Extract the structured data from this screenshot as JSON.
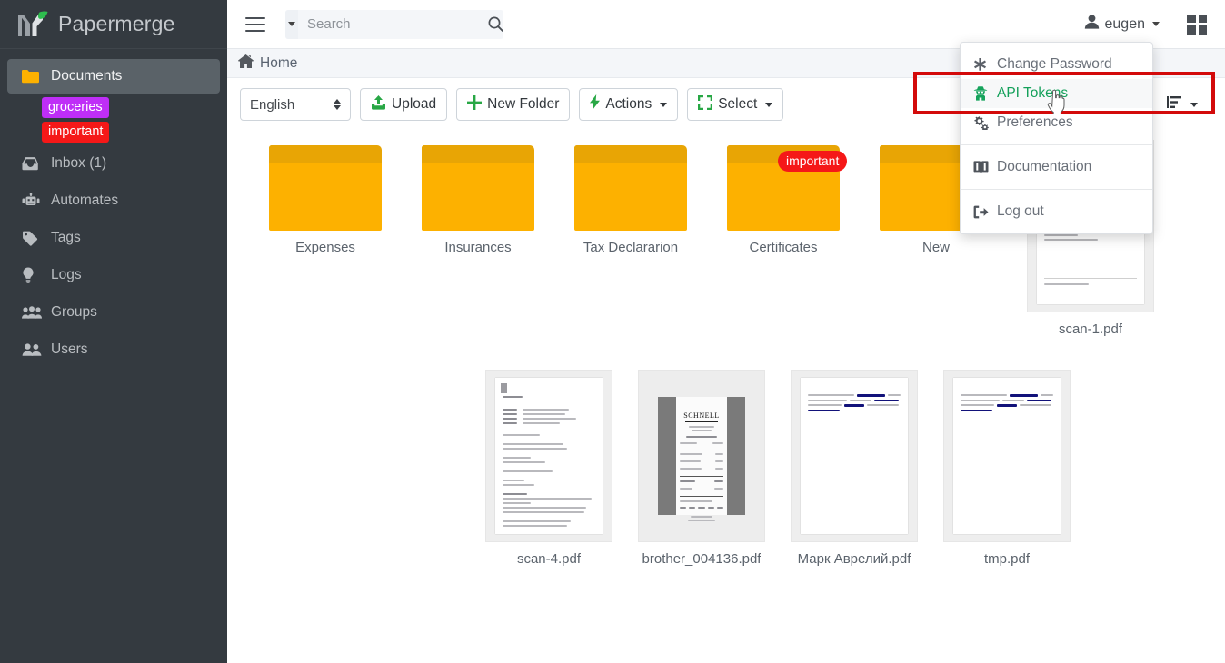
{
  "app": {
    "brand": "Papermerge",
    "logo_icon": "papermerge-leaf-logo"
  },
  "sidebar": {
    "items": [
      {
        "label": "Documents",
        "icon": "folder-icon",
        "active": true
      },
      {
        "label": "Inbox (1)",
        "icon": "inbox-icon",
        "active": false
      },
      {
        "label": "Automates",
        "icon": "robot-icon",
        "active": false
      },
      {
        "label": "Tags",
        "icon": "tag-icon",
        "active": false
      },
      {
        "label": "Logs",
        "icon": "lightbulb-icon",
        "active": false
      },
      {
        "label": "Groups",
        "icon": "groups-icon",
        "active": false
      },
      {
        "label": "Users",
        "icon": "users-icon",
        "active": false
      }
    ],
    "tags": [
      {
        "label": "groceries",
        "color": "#bf2ef7"
      },
      {
        "label": "important",
        "color": "#f51818"
      }
    ]
  },
  "topbar": {
    "menu_icon": "hamburger-icon",
    "search": {
      "placeholder": "Search",
      "value": "",
      "caret_icon": "chevron-down-icon",
      "submit_icon": "search-icon"
    },
    "user": {
      "name": "eugen",
      "icon": "user-icon",
      "caret_icon": "caret-down-icon"
    },
    "apps_icon": "grid-apps-icon"
  },
  "user_menu": {
    "items": [
      {
        "label": "Change Password",
        "icon": "asterisk-icon",
        "highlighted": false,
        "separator_after": false
      },
      {
        "label": "API Tokens",
        "icon": "user-secret-icon",
        "highlighted": true,
        "separator_after": false
      },
      {
        "label": "Preferences",
        "icon": "gears-icon",
        "highlighted": false,
        "separator_after": true
      },
      {
        "label": "Documentation",
        "icon": "book-icon",
        "highlighted": false,
        "separator_after": true
      },
      {
        "label": "Log out",
        "icon": "logout-icon",
        "highlighted": false,
        "separator_after": false
      }
    ],
    "highlight_color": "#14a05a",
    "annotation_box_color": "#d30a0a"
  },
  "breadcrumb": {
    "home_icon": "home-icon",
    "label": "Home"
  },
  "toolbar": {
    "language": "English",
    "upload_label": "Upload",
    "upload_icon": "upload-icon",
    "new_folder_label": "New Folder",
    "new_folder_icon": "plus-icon",
    "actions_label": "Actions",
    "actions_icon": "bolt-icon",
    "select_label": "Select",
    "select_icon": "select-frame-icon",
    "sort_icon": "sort-icon",
    "accent_color": "#28a745"
  },
  "content": {
    "folders": [
      {
        "name": "Expenses",
        "tag": null
      },
      {
        "name": "Insurances",
        "tag": null
      },
      {
        "name": "Tax Declararion",
        "tag": null
      },
      {
        "name": "Certificates",
        "tag": "important"
      },
      {
        "name": "New",
        "tag": null
      }
    ],
    "documents_row1": [
      {
        "name": "scan-1.pdf",
        "kind": "letter"
      }
    ],
    "documents_row2": [
      {
        "name": "scan-4.pdf",
        "kind": "letter"
      },
      {
        "name": "brother_004136.pdf",
        "kind": "receipt",
        "receipt_title": "SCHNELL"
      },
      {
        "name": "Марк Аврелий.pdf",
        "kind": "webpage"
      },
      {
        "name": "tmp.pdf",
        "kind": "webpage"
      }
    ]
  }
}
